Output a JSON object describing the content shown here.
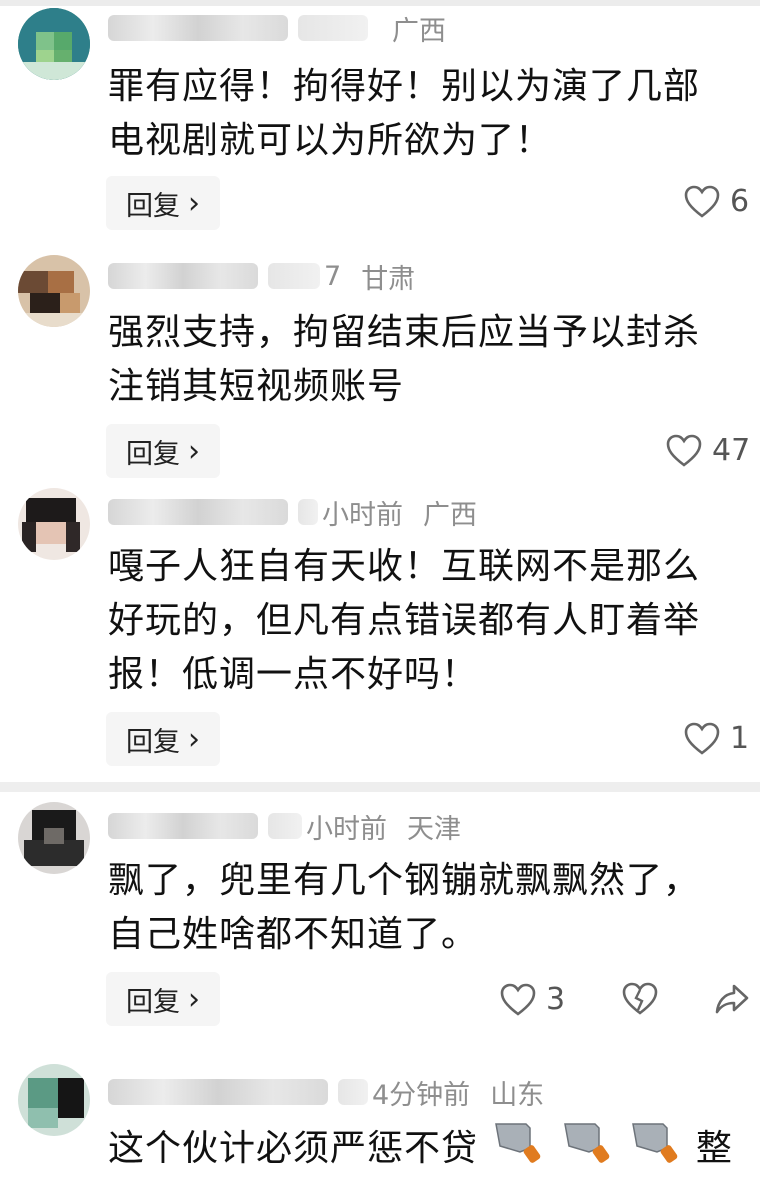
{
  "comments": [
    {
      "time": "",
      "location": "广西",
      "text_lines": [
        "罪有应得！拘得好！别以为演了几部",
        "电视剧就可以为所欲为了！"
      ],
      "reply_label": "回复",
      "likes": "6"
    },
    {
      "time": "7",
      "location": "甘肃",
      "text_lines": [
        "强烈支持，拘留结束后应当予以封杀",
        "注销其短视频账号"
      ],
      "reply_label": "回复",
      "likes": "47"
    },
    {
      "time": "小时前",
      "location": "广西",
      "text_lines": [
        "嘎子人狂自有天收！互联网不是那么",
        "好玩的，但凡有点错误都有人盯着举",
        "报！低调一点不好吗！"
      ],
      "reply_label": "回复",
      "likes": "1"
    },
    {
      "time": "小时前",
      "location": "天津",
      "text_lines": [
        "飘了，兜里有几个钢镚就飘飘然了，",
        "自己姓啥都不知道了。"
      ],
      "reply_label": "回复",
      "likes": "3"
    },
    {
      "time": "4分钟前",
      "location": "山东",
      "text_lines": [
        "这个伙计必须严惩不贷"
      ],
      "text_suffix": "整"
    }
  ],
  "icons": {
    "chevron": "›",
    "like": "heart-outline-icon",
    "dislike": "broken-heart-icon",
    "share": "share-arrow-icon",
    "knife": "kitchen-knife-emoji"
  },
  "colors": {
    "meta_text": "#8e8e8e",
    "reply_bg": "#f5f5f5",
    "separator": "#eeeeee"
  }
}
